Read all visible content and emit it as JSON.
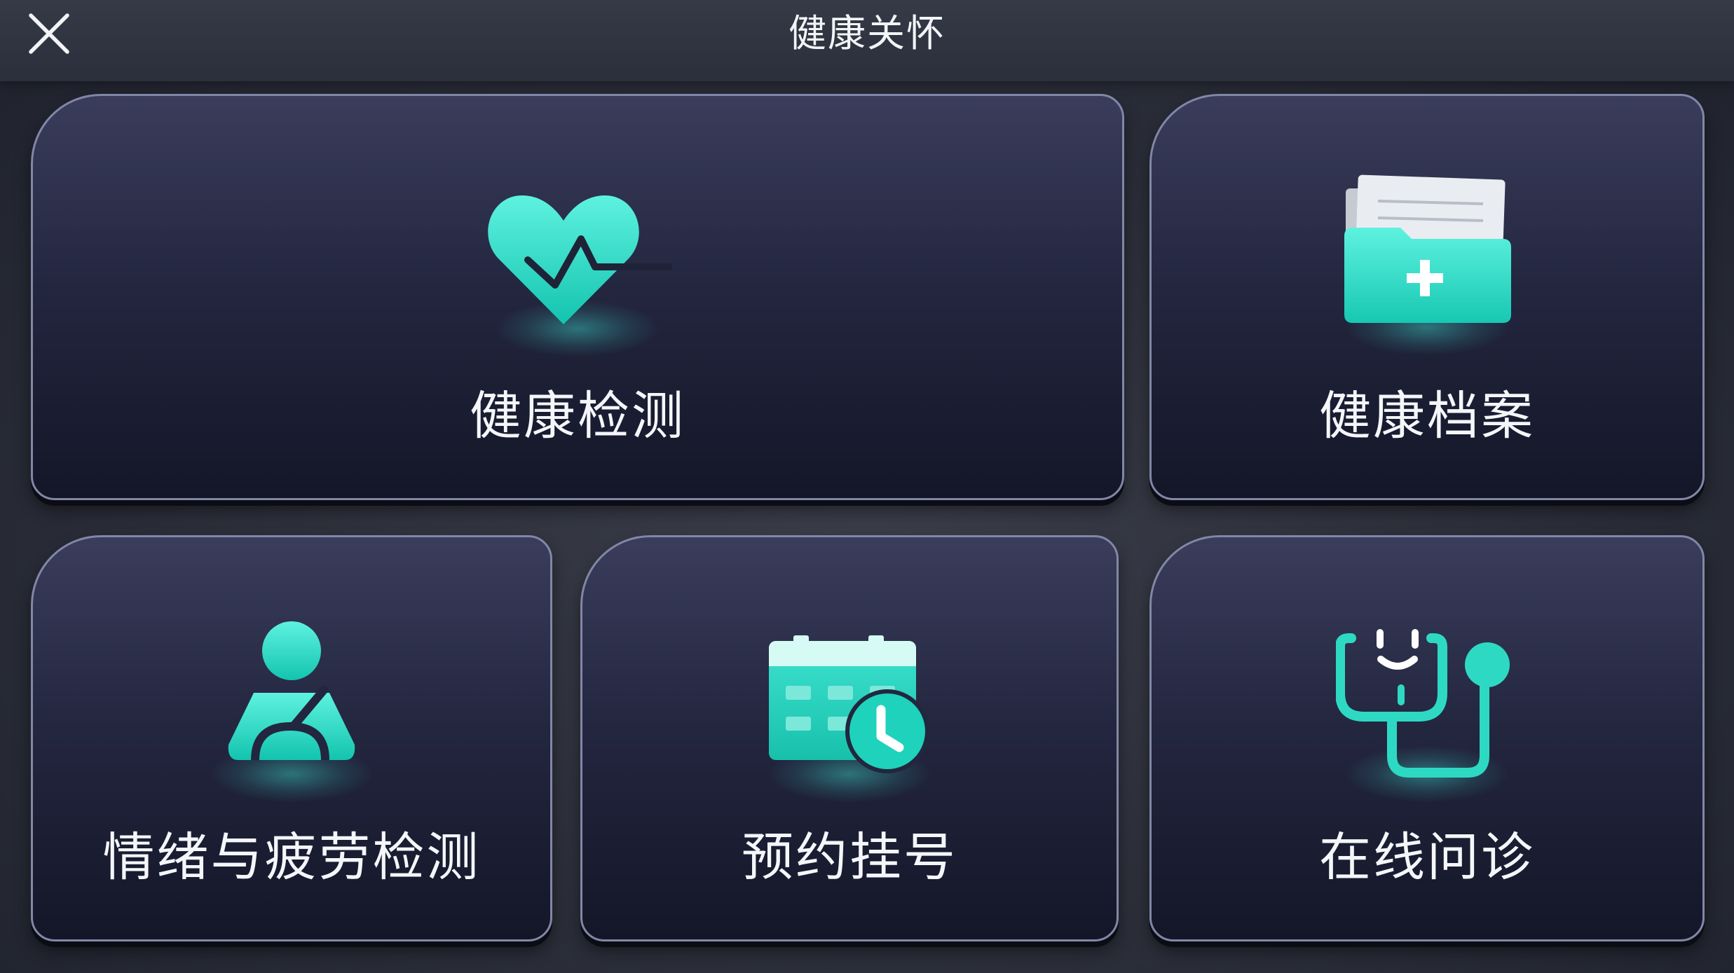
{
  "header": {
    "title": "健康关怀",
    "close_icon": "close-icon"
  },
  "colors": {
    "accent": "#2ed9c3",
    "accent_light": "#5ef2e0",
    "card_border": "#8187a6",
    "background": "#2e313c",
    "text": "#f4f6f9"
  },
  "menu": {
    "health_check": {
      "label": "健康检测",
      "icon": "heart-pulse-icon"
    },
    "health_records": {
      "label": "健康档案",
      "icon": "medical-folder-icon"
    },
    "emotion_fatigue_check": {
      "label": "情绪与疲劳检测",
      "icon": "driver-seatbelt-icon"
    },
    "appointment": {
      "label": "预约挂号",
      "icon": "calendar-clock-icon"
    },
    "online_consultation": {
      "label": "在线问诊",
      "icon": "stethoscope-icon"
    }
  }
}
